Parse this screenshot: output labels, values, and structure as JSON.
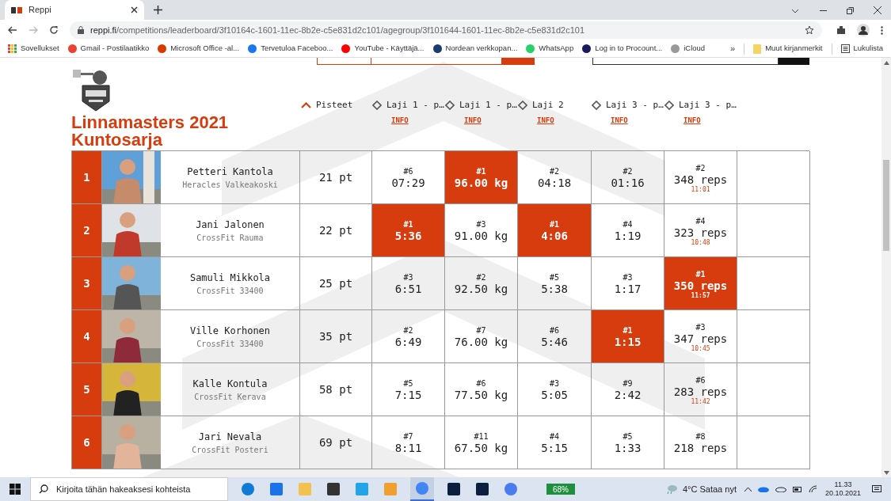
{
  "browser": {
    "tab_title": "Reppi",
    "url_host": "reppi.fi",
    "url_path": "/competitions/leaderboard/3f10164c-1601-11ec-8b2e-c5e831d2c101/agegroup/3f101644-1601-11ec-8b2e-c5e831d2c101",
    "bookmarks": [
      "Sovellukset",
      "Gmail - Postilaatikko",
      "Microsoft Office -al...",
      "Tervetuloa Faceboo...",
      "YouTube - Käyttäjä...",
      "Nordean verkkopan...",
      "WhatsApp",
      "Log in to Procount...",
      "iCloud"
    ],
    "more": "»",
    "other_bookmarks": "Muut kirjanmerkit",
    "reading_list": "Lukulista"
  },
  "page": {
    "title": "Linnamasters 2021",
    "subtitle": "Kuntosarja",
    "columns": [
      {
        "label": "Pisteet",
        "sorted": true
      },
      {
        "label": "Laji 1 - p…",
        "sorted": false,
        "link": "INFO"
      },
      {
        "label": "Laji 1 - p…",
        "sorted": false,
        "link": "INFO"
      },
      {
        "label": "Laji 2",
        "sorted": false,
        "link": "INFO"
      },
      {
        "label": "Laji 3 - p…",
        "sorted": false,
        "link": "INFO"
      },
      {
        "label": "Laji 3 - p…",
        "sorted": false,
        "link": "INFO"
      }
    ],
    "rows": [
      {
        "rank": "1",
        "name": "Petteri Kantola",
        "club": "Heracles Valkeakoski",
        "points": "21 pt",
        "results": [
          {
            "place": "#6",
            "score": "07:29",
            "best": false
          },
          {
            "place": "#1",
            "score": "96.00 kg",
            "best": true
          },
          {
            "place": "#2",
            "score": "04:18",
            "best": false
          },
          {
            "place": "#2",
            "score": "01:16",
            "best": false
          },
          {
            "place": "#2",
            "score": "348 reps",
            "time": "11:01",
            "best": false
          }
        ]
      },
      {
        "rank": "2",
        "name": "Jani Jalonen",
        "club": "CrossFit Rauma",
        "points": "22 pt",
        "results": [
          {
            "place": "#1",
            "score": "5:36",
            "best": true
          },
          {
            "place": "#3",
            "score": "91.00 kg",
            "best": false
          },
          {
            "place": "#1",
            "score": "4:06",
            "best": true
          },
          {
            "place": "#4",
            "score": "1:19",
            "best": false
          },
          {
            "place": "#4",
            "score": "323 reps",
            "time": "10:48",
            "best": false
          }
        ]
      },
      {
        "rank": "3",
        "name": "Samuli Mikkola",
        "club": "CrossFit 33400",
        "points": "25 pt",
        "results": [
          {
            "place": "#3",
            "score": "6:51",
            "best": false
          },
          {
            "place": "#2",
            "score": "92.50 kg",
            "best": false
          },
          {
            "place": "#5",
            "score": "5:38",
            "best": false
          },
          {
            "place": "#3",
            "score": "1:17",
            "best": false
          },
          {
            "place": "#1",
            "score": "350 reps",
            "time": "11:57",
            "best": true
          }
        ]
      },
      {
        "rank": "4",
        "name": "Ville Korhonen",
        "club": "CrossFit 33400",
        "points": "35 pt",
        "results": [
          {
            "place": "#2",
            "score": "6:49",
            "best": false
          },
          {
            "place": "#7",
            "score": "76.00 kg",
            "best": false
          },
          {
            "place": "#6",
            "score": "5:46",
            "best": false
          },
          {
            "place": "#1",
            "score": "1:15",
            "best": true
          },
          {
            "place": "#3",
            "score": "347 reps",
            "time": "10:45",
            "best": false
          }
        ]
      },
      {
        "rank": "5",
        "name": "Kalle Kontula",
        "club": "CrossFit Kerava",
        "points": "58 pt",
        "results": [
          {
            "place": "#5",
            "score": "7:15",
            "best": false
          },
          {
            "place": "#6",
            "score": "77.50 kg",
            "best": false
          },
          {
            "place": "#3",
            "score": "5:05",
            "best": false
          },
          {
            "place": "#9",
            "score": "2:42",
            "best": false
          },
          {
            "place": "#6",
            "score": "283 reps",
            "time": "11:42",
            "best": false
          }
        ]
      },
      {
        "rank": "6",
        "name": "Jari Nevala",
        "club": "CrossFit Posteri",
        "points": "69 pt",
        "results": [
          {
            "place": "#7",
            "score": "8:11",
            "best": false
          },
          {
            "place": "#11",
            "score": "67.50 kg",
            "best": false
          },
          {
            "place": "#4",
            "score": "5:15",
            "best": false
          },
          {
            "place": "#5",
            "score": "1:33",
            "best": false
          },
          {
            "place": "#8",
            "score": "218 reps",
            "best": false
          }
        ]
      }
    ]
  },
  "taskbar": {
    "search_placeholder": "Kirjoita tähän hakeaksesi kohteista",
    "battery": "68%",
    "weather": "4°C Sataa nyt",
    "time": "11.33",
    "date": "20.10.2021"
  }
}
